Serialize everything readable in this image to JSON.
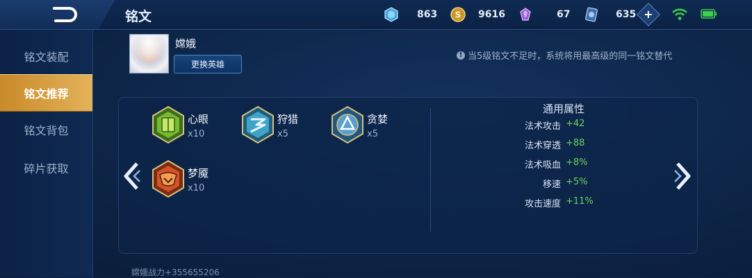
{
  "header": {
    "title": "铭文"
  },
  "resources": [
    {
      "name": "diamond",
      "icon": "blue-crystal-icon",
      "value": "863"
    },
    {
      "name": "gold",
      "icon": "gold-coin-icon",
      "value": "9616"
    },
    {
      "name": "gem",
      "icon": "purple-gem-icon",
      "value": "67"
    },
    {
      "name": "voucher",
      "icon": "blue-card-icon",
      "value": "635"
    }
  ],
  "status": {
    "wifi": "wifi-icon",
    "battery": "battery-icon"
  },
  "sidebar": {
    "items": [
      {
        "label": "铭文装配",
        "active": false
      },
      {
        "label": "铭文推荐",
        "active": true
      },
      {
        "label": "铭文背包",
        "active": false
      },
      {
        "label": "碎片获取",
        "active": false
      }
    ]
  },
  "hero": {
    "name": "嫦娥",
    "change_label": "更换英雄"
  },
  "hint": "当5级铭文不足时，系统将用最高级的同一铭文替代",
  "runes": [
    {
      "name": "心眼",
      "count": "x10",
      "color": "#7ab832"
    },
    {
      "name": "狩猎",
      "count": "x5",
      "color": "#3fa3c8"
    },
    {
      "name": "贪婪",
      "count": "x5",
      "color": "#5aa0cf"
    },
    {
      "name": "梦魇",
      "count": "x10",
      "color": "#d2542a"
    }
  ],
  "stats": {
    "title": "通用属性",
    "rows": [
      {
        "label": "法术攻击",
        "value": "+42"
      },
      {
        "label": "法术穿透",
        "value": "+88"
      },
      {
        "label": "法术吸血",
        "value": "+8%"
      },
      {
        "label": "移速",
        "value": "+5%"
      },
      {
        "label": "攻击速度",
        "value": "+11%"
      }
    ]
  },
  "footer": "嫦娥战力+355655206"
}
